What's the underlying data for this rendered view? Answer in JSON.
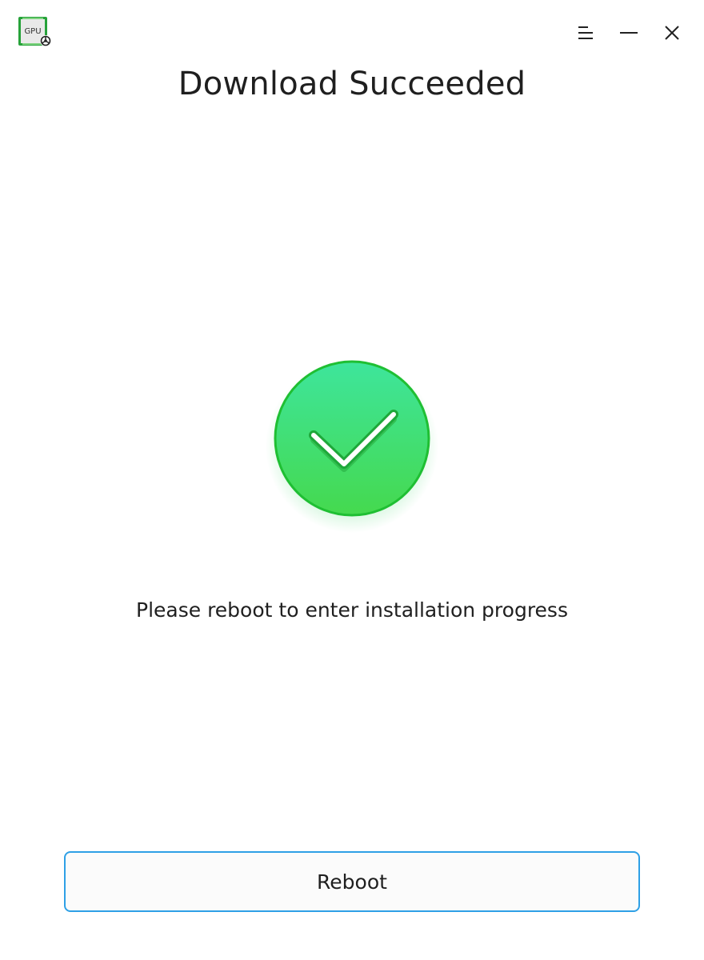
{
  "app": {
    "icon_name": "gpu-driver-app-icon",
    "icon_text": "GPU"
  },
  "window_controls": {
    "menu_icon": "menu-icon",
    "minimize_icon": "minimize-icon",
    "close_icon": "close-icon"
  },
  "main": {
    "title": "Download Succeeded",
    "status_icon": "success-check-icon",
    "message": "Please reboot to enter installation progress",
    "reboot_button_label": "Reboot"
  },
  "colors": {
    "success_green_top": "#3ee59c",
    "success_green_bottom": "#45d94e",
    "button_border": "#2ea0e6"
  }
}
